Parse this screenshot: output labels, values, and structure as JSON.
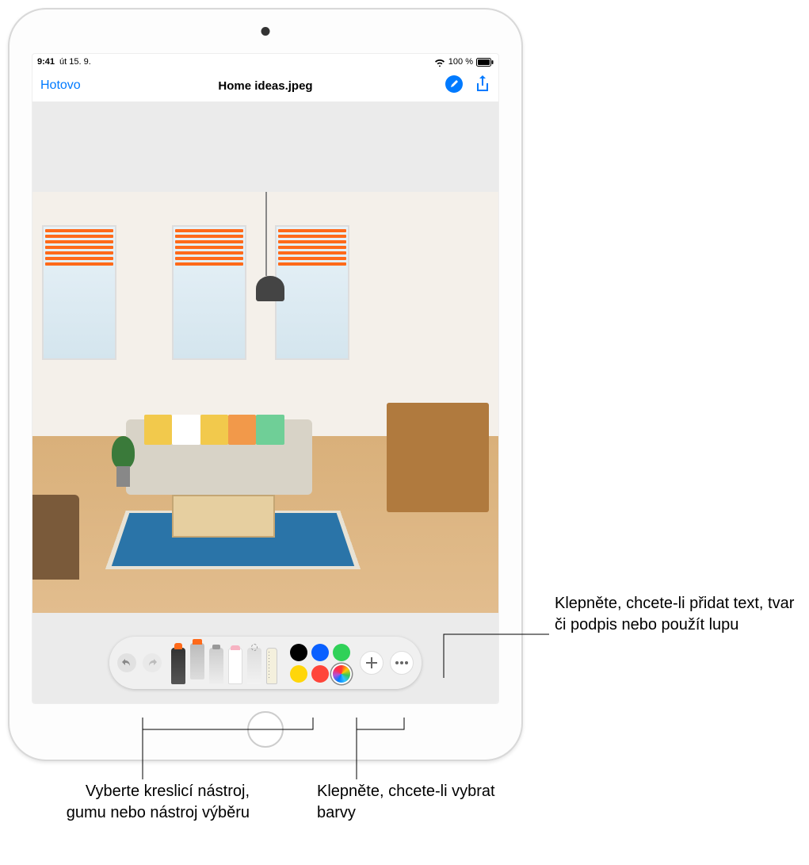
{
  "status": {
    "time": "9:41",
    "date": "út 15. 9.",
    "battery": "100 %",
    "wifi_icon": "wifi",
    "battery_icon": "battery-full"
  },
  "nav": {
    "done_label": "Hotovo",
    "title": "Home ideas.jpeg",
    "markup_icon": "markup-pen-circle",
    "share_icon": "share"
  },
  "toolbar": {
    "undo_icon": "undo",
    "redo_icon": "redo",
    "tools": [
      {
        "name": "pen",
        "selected": false
      },
      {
        "name": "marker",
        "selected": true
      },
      {
        "name": "pencil",
        "selected": false
      },
      {
        "name": "eraser",
        "selected": false
      },
      {
        "name": "lasso",
        "selected": false
      },
      {
        "name": "ruler",
        "selected": false
      }
    ],
    "colors": [
      {
        "hex": "#000000",
        "selected": false
      },
      {
        "hex": "#0a60ff",
        "selected": false
      },
      {
        "hex": "#30d158",
        "selected": false
      },
      {
        "hex": "#ffd60a",
        "selected": false
      },
      {
        "hex": "#ff453a",
        "selected": false
      },
      {
        "hex": "multicolor",
        "selected": true
      }
    ],
    "add_icon": "plus",
    "more_icon": "ellipsis"
  },
  "image": {
    "annotation_color": "#ff6a1a",
    "description": "Living room photo with hand-drawn orange blinds on three windows"
  },
  "callouts": {
    "add": "Klepněte, chcete-li přidat text, tvar či podpis nebo použít lupu",
    "tools": "Vyberte kreslicí nástroj, gumu nebo nástroj výběru",
    "colors": "Klepněte, chcete-li vybrat barvy"
  }
}
